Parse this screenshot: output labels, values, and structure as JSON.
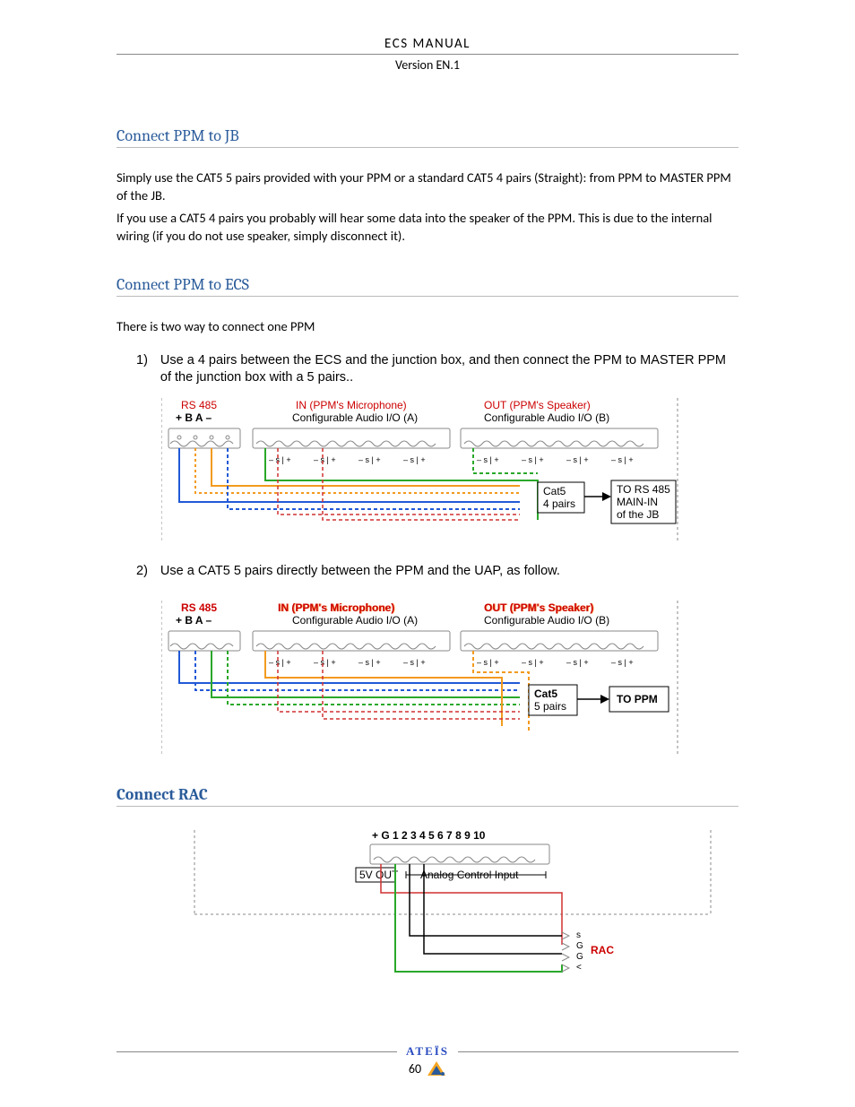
{
  "header": {
    "title": "ECS  MANUAL",
    "version": "Version EN.1"
  },
  "section1": {
    "heading": "Connect PPM to JB",
    "p1": "Simply use the CAT5 5 pairs provided with your PPM or a standard CAT5 4 pairs (Straight):  from PPM to MASTER PPM of the JB.",
    "p2": "If you use a CAT5 4 pairs you probably will hear some data into the speaker of the PPM. This is due to the internal wiring (if you do not use speaker, simply disconnect it)."
  },
  "section2": {
    "heading": "Connect PPM to ECS",
    "intro": "There is two way to connect one PPM",
    "item1_marker": "1)",
    "item1": "Use a 4 pairs between the ECS and the junction box, and then connect the PPM to MASTER PPM of the junction box with a 5 pairs..",
    "item2_marker": "2)",
    "item2": "Use a CAT5 5 pairs directly between the PPM and the UAP, as follow."
  },
  "diagram1": {
    "rs485": "RS 485",
    "in_title": "IN (PPM's Microphone)",
    "out_title": "OUT (PPM's Speaker)",
    "io_a": "Configurable Audio I/O (A)",
    "io_b": "Configurable Audio I/O (B)",
    "rs485_pins": "+   B   A   –",
    "term_group": "–   s | +",
    "cat5": "Cat5",
    "pairs": "4 pairs",
    "right1": "TO RS 485",
    "right2": "MAIN-IN",
    "right3": "of the JB"
  },
  "diagram2": {
    "rs485": "RS 485",
    "in_title": "IN (PPM's Microphone)",
    "out_title": "OUT (PPM's Speaker)",
    "io_a": "Configurable Audio I/O (A)",
    "io_b": "Configurable Audio I/O (B)",
    "rs485_pins": "+   B   A   –",
    "term_group": "–   s | +",
    "cat5": "Cat5",
    "pairs": "5 pairs",
    "right1": "TO PPM"
  },
  "section3": {
    "heading": "Connect RAC"
  },
  "diagram3": {
    "pins": "+   G   1   2   3   4   5   6   7   8   9  10",
    "left": "5V OUT",
    "right": "Analog Control Input",
    "side_s": "s",
    "side_g": "G",
    "side_lt": "<",
    "rac": "RAC"
  },
  "footer": {
    "brand": "ATEÏS",
    "page": "60"
  }
}
